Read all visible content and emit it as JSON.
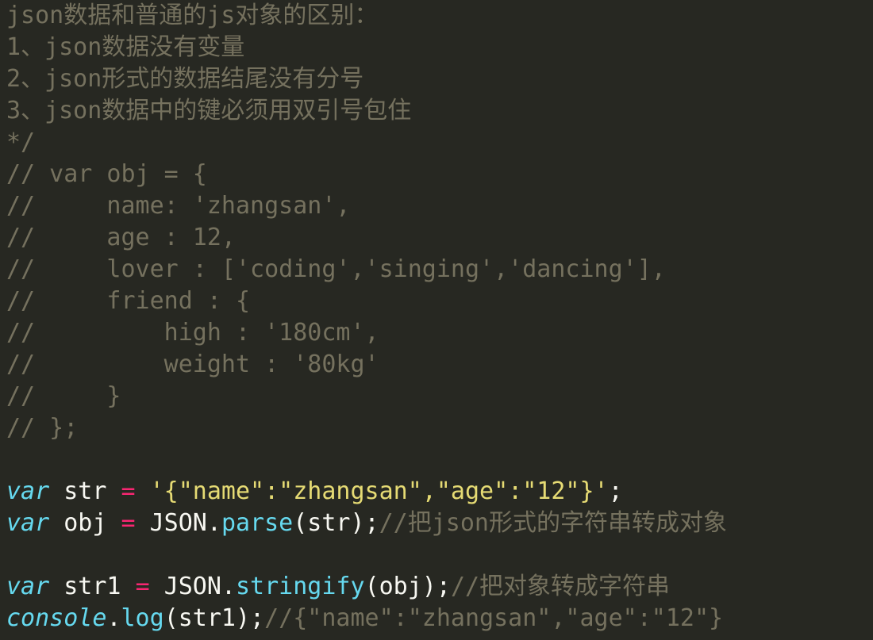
{
  "editor": {
    "comment_block": [
      "json数据和普通的js对象的区别：",
      "1、json数据没有变量",
      "2、json形式的数据结尾没有分号",
      "3、json数据中的键必须用双引号包住",
      "*/",
      "// var obj = {",
      "//     name: 'zhangsan',",
      "//     age : 12,",
      "//     lover : ['coding','singing','dancing'],",
      "//     friend : {",
      "//         high : '180cm',",
      "//         weight : '80kg'",
      "//     }",
      "// };"
    ],
    "code": {
      "line1": {
        "kw": "var",
        "name": " str ",
        "op": "=",
        "value": "'{\"name\":\"zhangsan\",\"age\":\"12\"}'",
        "end": ";"
      },
      "line2": {
        "kw": "var",
        "name": " obj ",
        "op": "=",
        "obj": "JSON",
        "dot": ".",
        "method": "parse",
        "args": "(str);",
        "comment": "//把json形式的字符串转成对象"
      },
      "line3": {
        "kw": "var",
        "name": " str1 ",
        "op": "=",
        "obj": "JSON",
        "dot": ".",
        "method": "stringify",
        "args": "(obj);",
        "comment": "//把对象转成字符串"
      },
      "line4": {
        "kw": "console",
        "dot": ".",
        "method": "log",
        "args": "(str1);",
        "comment": "//{\"name\":\"zhangsan\",\"age\":\"12\"}"
      }
    }
  }
}
